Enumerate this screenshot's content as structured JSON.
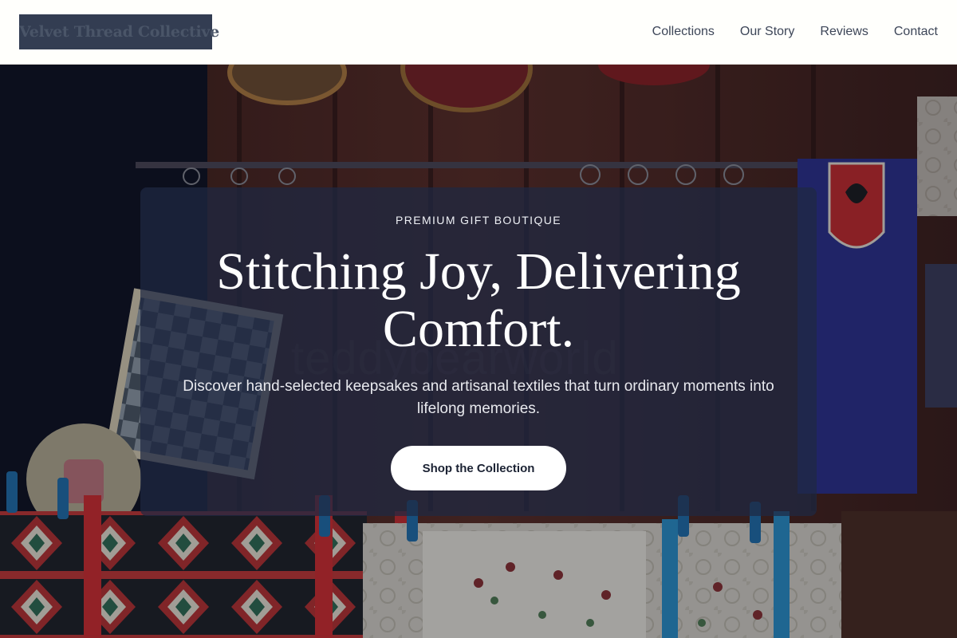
{
  "header": {
    "logo_text": "Velvet Thread Collective",
    "nav": [
      {
        "label": "Collections"
      },
      {
        "label": "Our Story"
      },
      {
        "label": "Reviews"
      },
      {
        "label": "Contact"
      }
    ]
  },
  "hero": {
    "background_image": "shop display of hanging embroidered textiles, kilim rugs, crochet lace cloths, wall plates and a flag",
    "watermark_text": "teddybearworld",
    "eyebrow": "PREMIUM GIFT BOUTIQUE",
    "headline": "Stitching Joy, Delivering Comfort.",
    "subtext": "Discover hand-selected keepsakes and artisanal textiles that turn ordinary moments into lifelong memories.",
    "cta_label": "Shop the Collection"
  },
  "colors": {
    "header_bg": "#fffffc",
    "logo_bg": "#333d52",
    "nav_text": "#3d4658",
    "card_bg": "#1e2842",
    "cta_bg": "#ffffff",
    "cta_text": "#1b2233"
  }
}
